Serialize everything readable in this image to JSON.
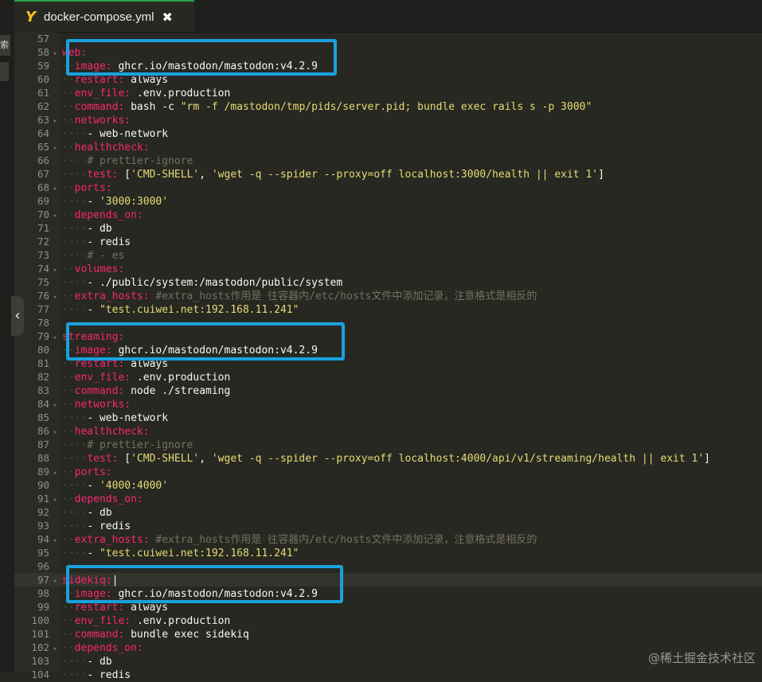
{
  "tab": {
    "title": "docker-compose.yml",
    "close": "✖",
    "icon": "Y"
  },
  "sidebar": {
    "search_label": "索",
    "collapse_glyph": "‹"
  },
  "watermark": "@稀土掘金技术社区",
  "highlight_color": "#1aa1dd",
  "syntax_colors": {
    "key": "#f92672",
    "string": "#e6db74",
    "comment": "#75715e",
    "text": "#f8f8f2"
  },
  "lines": [
    {
      "n": "57",
      "fold": "",
      "ind": 0,
      "t": []
    },
    {
      "n": "58",
      "fold": "▾",
      "ind": 0,
      "t": [
        [
          "k",
          "web:"
        ]
      ]
    },
    {
      "n": "59",
      "fold": "",
      "ind": 1,
      "t": [
        [
          "k",
          "image:"
        ],
        [
          "p",
          " ghcr.io/mastodon/mastodon:v4.2.9"
        ]
      ]
    },
    {
      "n": "60",
      "fold": "",
      "ind": 1,
      "t": [
        [
          "k",
          "restart:"
        ],
        [
          "p",
          " always"
        ]
      ]
    },
    {
      "n": "61",
      "fold": "",
      "ind": 1,
      "t": [
        [
          "k",
          "env_file:"
        ],
        [
          "p",
          " .env.production"
        ]
      ]
    },
    {
      "n": "62",
      "fold": "",
      "ind": 1,
      "t": [
        [
          "k",
          "command:"
        ],
        [
          "p",
          " bash -c "
        ],
        [
          "s",
          "\"rm -f /mastodon/tmp/pids/server.pid; bundle exec rails s -p 3000\""
        ]
      ]
    },
    {
      "n": "63",
      "fold": "▾",
      "ind": 1,
      "t": [
        [
          "k",
          "networks:"
        ]
      ]
    },
    {
      "n": "64",
      "fold": "",
      "ind": 2,
      "t": [
        [
          "p",
          "- web-network"
        ]
      ]
    },
    {
      "n": "65",
      "fold": "▾",
      "ind": 1,
      "t": [
        [
          "k",
          "healthcheck:"
        ]
      ]
    },
    {
      "n": "66",
      "fold": "",
      "ind": 2,
      "t": [
        [
          "c",
          "# prettier-ignore"
        ]
      ]
    },
    {
      "n": "67",
      "fold": "",
      "ind": 2,
      "t": [
        [
          "k",
          "test:"
        ],
        [
          "p",
          " ["
        ],
        [
          "s",
          "'CMD-SHELL'"
        ],
        [
          "p",
          ", "
        ],
        [
          "s",
          "'wget -q --spider --proxy=off localhost:3000/health || exit 1'"
        ],
        [
          "p",
          "]"
        ]
      ]
    },
    {
      "n": "68",
      "fold": "▾",
      "ind": 1,
      "t": [
        [
          "k",
          "ports:"
        ]
      ]
    },
    {
      "n": "69",
      "fold": "",
      "ind": 2,
      "t": [
        [
          "p",
          "- "
        ],
        [
          "s",
          "'3000:3000'"
        ]
      ]
    },
    {
      "n": "70",
      "fold": "▾",
      "ind": 1,
      "t": [
        [
          "k",
          "depends_on:"
        ]
      ]
    },
    {
      "n": "71",
      "fold": "",
      "ind": 2,
      "t": [
        [
          "p",
          "- db"
        ]
      ]
    },
    {
      "n": "72",
      "fold": "",
      "ind": 2,
      "t": [
        [
          "p",
          "- redis"
        ]
      ]
    },
    {
      "n": "73",
      "fold": "",
      "ind": 2,
      "t": [
        [
          "c",
          "# - es"
        ]
      ]
    },
    {
      "n": "74",
      "fold": "▾",
      "ind": 1,
      "t": [
        [
          "k",
          "volumes:"
        ]
      ]
    },
    {
      "n": "75",
      "fold": "",
      "ind": 2,
      "t": [
        [
          "p",
          "- ./public/system:/mastodon/public/system"
        ]
      ]
    },
    {
      "n": "76",
      "fold": "▾",
      "ind": 1,
      "t": [
        [
          "k",
          "extra_hosts:"
        ],
        [
          "c",
          " #extra_hosts作用是 往容器内/etc/hosts文件中添加记录，注意格式是相反的"
        ]
      ]
    },
    {
      "n": "77",
      "fold": "",
      "ind": 2,
      "t": [
        [
          "p",
          "- "
        ],
        [
          "s",
          "\"test.cuiwei.net:192.168.11.241\""
        ]
      ]
    },
    {
      "n": "78",
      "fold": "",
      "ind": 0,
      "t": []
    },
    {
      "n": "79",
      "fold": "▾",
      "ind": 0,
      "t": [
        [
          "k",
          "streaming:"
        ]
      ]
    },
    {
      "n": "80",
      "fold": "",
      "ind": 1,
      "t": [
        [
          "k",
          "image:"
        ],
        [
          "p",
          " ghcr.io/mastodon/mastodon:v4.2.9"
        ]
      ]
    },
    {
      "n": "81",
      "fold": "",
      "ind": 1,
      "t": [
        [
          "k",
          "restart:"
        ],
        [
          "p",
          " always"
        ]
      ]
    },
    {
      "n": "82",
      "fold": "",
      "ind": 1,
      "t": [
        [
          "k",
          "env_file:"
        ],
        [
          "p",
          " .env.production"
        ]
      ]
    },
    {
      "n": "83",
      "fold": "",
      "ind": 1,
      "t": [
        [
          "k",
          "command:"
        ],
        [
          "p",
          " node ./streaming"
        ]
      ]
    },
    {
      "n": "84",
      "fold": "▾",
      "ind": 1,
      "t": [
        [
          "k",
          "networks:"
        ]
      ]
    },
    {
      "n": "85",
      "fold": "",
      "ind": 2,
      "t": [
        [
          "p",
          "- web-network"
        ]
      ]
    },
    {
      "n": "86",
      "fold": "▾",
      "ind": 1,
      "t": [
        [
          "k",
          "healthcheck:"
        ]
      ]
    },
    {
      "n": "87",
      "fold": "",
      "ind": 2,
      "t": [
        [
          "c",
          "# prettier-ignore"
        ]
      ]
    },
    {
      "n": "88",
      "fold": "",
      "ind": 2,
      "t": [
        [
          "k",
          "test:"
        ],
        [
          "p",
          " ["
        ],
        [
          "s",
          "'CMD-SHELL'"
        ],
        [
          "p",
          ", "
        ],
        [
          "s",
          "'wget -q --spider --proxy=off localhost:4000/api/v1/streaming/health || exit 1'"
        ],
        [
          "p",
          "]"
        ]
      ]
    },
    {
      "n": "89",
      "fold": "▾",
      "ind": 1,
      "t": [
        [
          "k",
          "ports:"
        ]
      ]
    },
    {
      "n": "90",
      "fold": "",
      "ind": 2,
      "t": [
        [
          "p",
          "- "
        ],
        [
          "s",
          "'4000:4000'"
        ]
      ]
    },
    {
      "n": "91",
      "fold": "▾",
      "ind": 1,
      "t": [
        [
          "k",
          "depends_on:"
        ]
      ]
    },
    {
      "n": "92",
      "fold": "",
      "ind": 2,
      "t": [
        [
          "p",
          "- db"
        ]
      ]
    },
    {
      "n": "93",
      "fold": "",
      "ind": 2,
      "t": [
        [
          "p",
          "- redis"
        ]
      ]
    },
    {
      "n": "94",
      "fold": "▾",
      "ind": 1,
      "t": [
        [
          "k",
          "extra_hosts:"
        ],
        [
          "c",
          " #extra_hosts作用是 往容器内/etc/hosts文件中添加记录，注意格式是相反的"
        ]
      ]
    },
    {
      "n": "95",
      "fold": "",
      "ind": 2,
      "t": [
        [
          "p",
          "- "
        ],
        [
          "s",
          "\"test.cuiwei.net:192.168.11.241\""
        ]
      ]
    },
    {
      "n": "96",
      "fold": "",
      "ind": 0,
      "t": []
    },
    {
      "n": "97",
      "fold": "▾",
      "ind": 0,
      "cur": true,
      "t": [
        [
          "k",
          "sidekiq:"
        ],
        [
          "p",
          "|"
        ]
      ]
    },
    {
      "n": "98",
      "fold": "",
      "ind": 1,
      "t": [
        [
          "k",
          "image:"
        ],
        [
          "p",
          " ghcr.io/mastodon/mastodon:v4.2.9"
        ]
      ]
    },
    {
      "n": "99",
      "fold": "",
      "ind": 1,
      "t": [
        [
          "k",
          "restart:"
        ],
        [
          "p",
          " always"
        ]
      ]
    },
    {
      "n": "100",
      "fold": "",
      "ind": 1,
      "t": [
        [
          "k",
          "env_file:"
        ],
        [
          "p",
          " .env.production"
        ]
      ]
    },
    {
      "n": "101",
      "fold": "",
      "ind": 1,
      "t": [
        [
          "k",
          "command:"
        ],
        [
          "p",
          " bundle exec sidekiq"
        ]
      ]
    },
    {
      "n": "102",
      "fold": "▾",
      "ind": 1,
      "t": [
        [
          "k",
          "depends_on:"
        ]
      ]
    },
    {
      "n": "103",
      "fold": "",
      "ind": 2,
      "t": [
        [
          "p",
          "- db"
        ]
      ]
    },
    {
      "n": "104",
      "fold": "",
      "ind": 2,
      "t": [
        [
          "p",
          "- redis"
        ]
      ]
    }
  ]
}
